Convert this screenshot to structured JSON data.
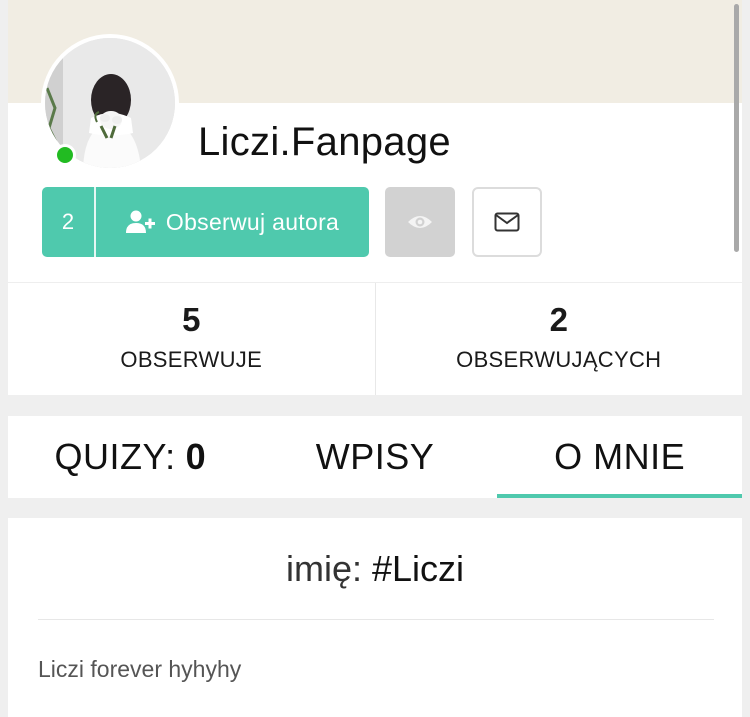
{
  "profile": {
    "username": "Liczi.Fanpage",
    "online": true,
    "follow_count": "2",
    "follow_label": "Obserwuj autora",
    "icons": {
      "follow": "user-plus-icon",
      "watch": "eye-icon",
      "message": "envelope-icon"
    },
    "colors": {
      "accent": "#4fc9ad",
      "cover": "#f1ede3",
      "online": "#22bb22"
    }
  },
  "stats": [
    {
      "value": "5",
      "label": "OBSERWUJE"
    },
    {
      "value": "2",
      "label": "OBSERWUJĄCYCH"
    }
  ],
  "tabs": [
    {
      "label": "QUIZY:",
      "count": "0",
      "active": false
    },
    {
      "label": "WPISY",
      "active": false
    },
    {
      "label": "O MNIE",
      "active": true
    }
  ],
  "about": {
    "name_label": "imię:",
    "name_value": "#Liczi",
    "description": "Liczi forever hyhyhy"
  }
}
